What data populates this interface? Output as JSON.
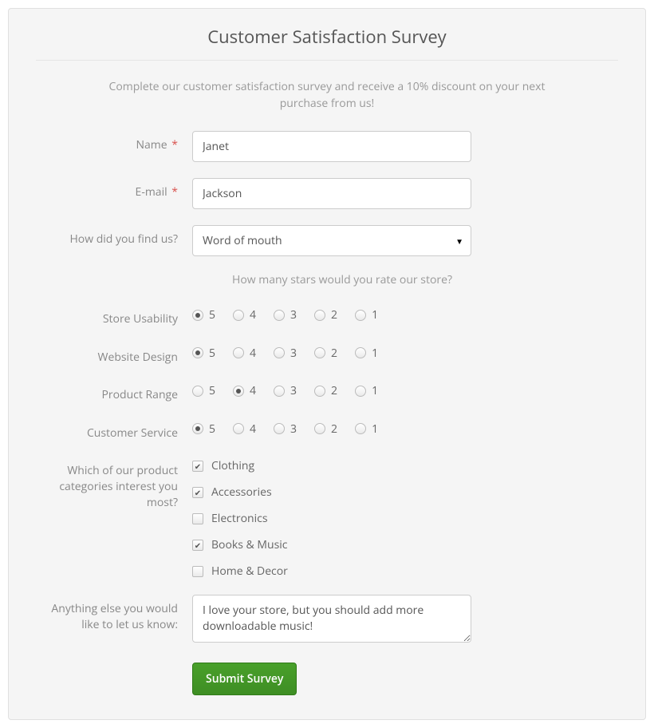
{
  "title": "Customer Satisfaction Survey",
  "intro": "Complete our customer satisfaction survey and receive a 10% discount on your next purchase from us!",
  "fields": {
    "name": {
      "label": "Name",
      "required": true,
      "value": "Janet"
    },
    "email": {
      "label": "E-mail",
      "required": true,
      "value": "Jackson"
    },
    "find_us": {
      "label": "How did you find us?",
      "value": "Word of mouth"
    }
  },
  "rating_header": "How many stars would you rate our store?",
  "rating_scale": [
    "5",
    "4",
    "3",
    "2",
    "1"
  ],
  "ratings": [
    {
      "label": "Store Usability",
      "selected": "5"
    },
    {
      "label": "Website Design",
      "selected": "5"
    },
    {
      "label": "Product Range",
      "selected": "4"
    },
    {
      "label": "Customer Service",
      "selected": "5"
    }
  ],
  "categories": {
    "label": "Which of our product categories interest you most?",
    "options": [
      {
        "label": "Clothing",
        "checked": true
      },
      {
        "label": "Accessories",
        "checked": true
      },
      {
        "label": "Electronics",
        "checked": false
      },
      {
        "label": "Books & Music",
        "checked": true
      },
      {
        "label": "Home & Decor",
        "checked": false
      }
    ]
  },
  "comments": {
    "label": "Anything else you would like to let us know:",
    "value": "I love your store, but you should add more downloadable music!"
  },
  "submit_label": "Submit Survey"
}
